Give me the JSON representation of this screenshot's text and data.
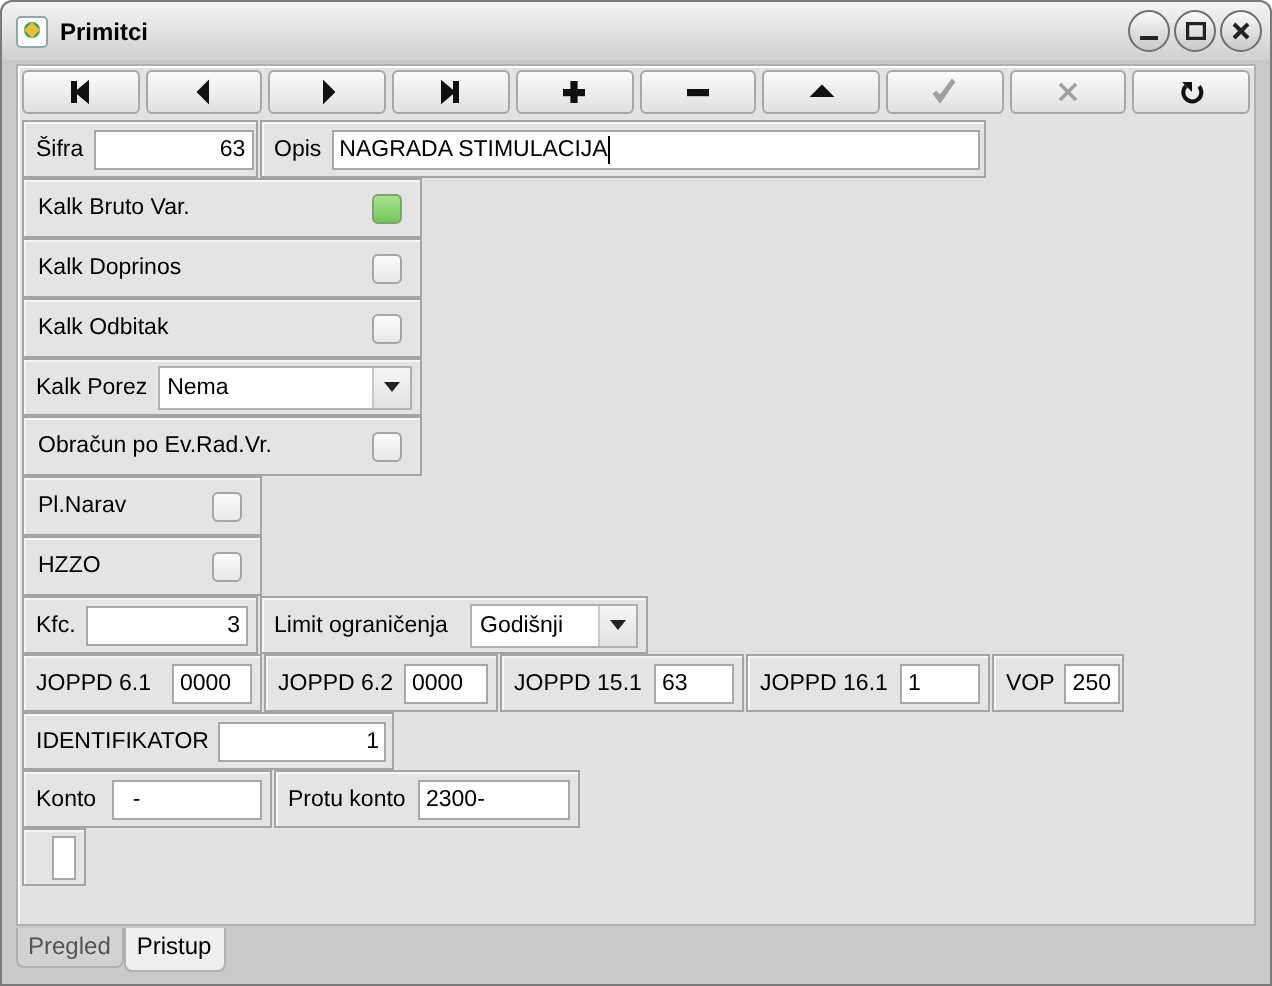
{
  "window": {
    "title": "Primitci"
  },
  "title_buttons": [
    {
      "kind": "minimize"
    },
    {
      "kind": "maximize"
    },
    {
      "kind": "close"
    }
  ],
  "toolbar": [
    {
      "kind": "first",
      "disabled": false
    },
    {
      "kind": "previous",
      "disabled": false
    },
    {
      "kind": "next",
      "disabled": false
    },
    {
      "kind": "last",
      "disabled": false
    },
    {
      "kind": "add",
      "disabled": false
    },
    {
      "kind": "remove",
      "disabled": false
    },
    {
      "kind": "up",
      "disabled": false
    },
    {
      "kind": "confirm",
      "disabled": true
    },
    {
      "kind": "cancel",
      "disabled": true
    },
    {
      "kind": "refresh",
      "disabled": false
    }
  ],
  "rows": [
    {
      "cells": [
        {
          "kind": "number",
          "label": "Šifra",
          "value": "63"
        },
        {
          "kind": "text",
          "label": "Opis",
          "value": "NAGRADA STIMULACIJA",
          "focused": true
        }
      ]
    },
    {
      "cells": [
        {
          "kind": "checkbox",
          "label": "Kalk Bruto Var.",
          "checked": true
        }
      ]
    },
    {
      "cells": [
        {
          "kind": "checkbox",
          "label": "Kalk Doprinos",
          "checked": false
        }
      ]
    },
    {
      "cells": [
        {
          "kind": "checkbox",
          "label": "Kalk Odbitak",
          "checked": false
        }
      ]
    },
    {
      "cells": [
        {
          "kind": "combo",
          "label": "Kalk Porez",
          "value": "Nema"
        }
      ]
    },
    {
      "cells": [
        {
          "kind": "checkbox",
          "label": "Obračun po Ev.Rad.Vr.",
          "checked": false
        }
      ]
    },
    {
      "cells": [
        {
          "kind": "checkbox",
          "label": "Pl.Narav",
          "checked": false
        }
      ]
    },
    {
      "cells": [
        {
          "kind": "checkbox",
          "label": "HZZO",
          "checked": false
        }
      ]
    },
    {
      "cells": [
        {
          "kind": "number",
          "label": "Kfc.",
          "value": "3"
        },
        {
          "kind": "combo",
          "label": "Limit ograničenja",
          "value": "Godišnji"
        }
      ]
    },
    {
      "cells": [
        {
          "kind": "text",
          "label": "JOPPD 6.1",
          "value": "0000"
        },
        {
          "kind": "text",
          "label": "JOPPD 6.2",
          "value": "0000"
        },
        {
          "kind": "text",
          "label": "JOPPD 15.1",
          "value": "63"
        },
        {
          "kind": "text",
          "label": "JOPPD 16.1",
          "value": "1"
        },
        {
          "kind": "text",
          "label": "VOP",
          "value": "250"
        }
      ]
    },
    {
      "cells": [
        {
          "kind": "number",
          "label": "IDENTIFIKATOR",
          "value": "1"
        }
      ]
    },
    {
      "cells": [
        {
          "kind": "text",
          "label": "Konto",
          "value": "  -"
        },
        {
          "kind": "text",
          "label": "Protu konto",
          "value": "2300-"
        }
      ]
    },
    {
      "cells": [
        {
          "kind": "empty"
        }
      ]
    }
  ],
  "tabs": [
    {
      "label": "Pregled",
      "selected": false
    },
    {
      "label": "Pristup",
      "selected": true
    }
  ]
}
